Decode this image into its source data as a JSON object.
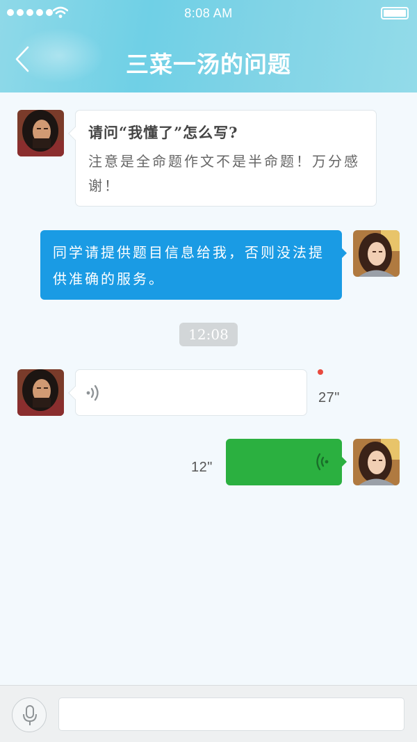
{
  "status_bar": {
    "time": "8:08 AM",
    "signal_icon": "signal-dots-icon",
    "wifi_icon": "wifi-icon",
    "battery_icon": "battery-icon"
  },
  "nav": {
    "title": "三菜一汤的问题",
    "back_icon": "chevron-left-icon"
  },
  "messages": [
    {
      "direction": "incoming",
      "type": "text",
      "avatar": "student-avatar",
      "title": "请问“我懂了”怎么写?",
      "body": "注意是全命题作文不是半命题！万分感谢！"
    },
    {
      "direction": "outgoing",
      "type": "text",
      "avatar": "teacher-avatar",
      "body": "同学请提供题目信息给我，否则没法提供准确的服务。"
    },
    {
      "type": "timestamp",
      "text": "12:08"
    },
    {
      "direction": "incoming",
      "type": "voice",
      "avatar": "student-avatar",
      "duration": "27\"",
      "unread": true
    },
    {
      "direction": "outgoing",
      "type": "voice",
      "avatar": "teacher-avatar",
      "duration": "12\""
    }
  ],
  "input_bar": {
    "mic_icon": "microphone-icon",
    "placeholder": ""
  },
  "colors": {
    "header": "#6fd0e6",
    "outgoing_text_bubble": "#1a9be4",
    "outgoing_voice_bubble": "#2bb040",
    "unread_dot": "#e84a3f",
    "background": "#f3f9fd"
  }
}
